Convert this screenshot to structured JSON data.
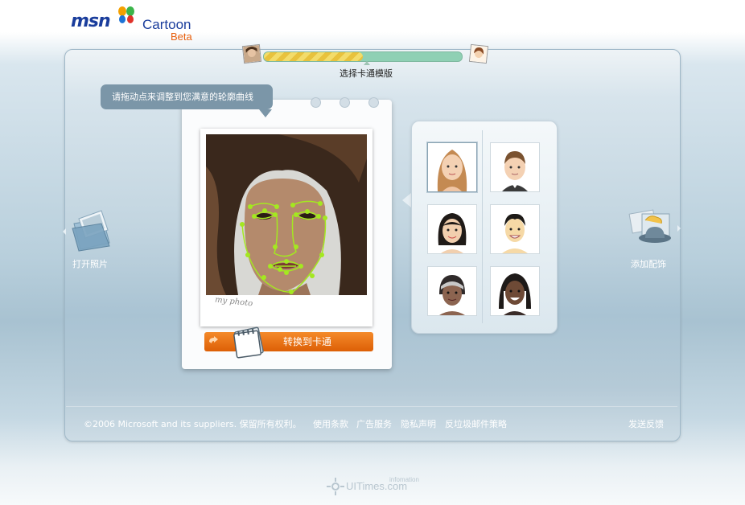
{
  "header": {
    "brand": "msn",
    "product": "Cartoon",
    "badge": "Beta"
  },
  "progress": {
    "fraction": 0.5,
    "step_label": "选择卡通模版"
  },
  "editor": {
    "tooltip": "请拖动点来调整到您满意的轮廓曲线",
    "photo_caption": "my photo",
    "convert_label": "转换到卡通"
  },
  "actions": {
    "open_photo": "打开照片",
    "add_accessory": "添加配饰"
  },
  "templates": [
    {
      "name": "template-woman-long-hair",
      "selected": true
    },
    {
      "name": "template-man-short-hair",
      "selected": false
    },
    {
      "name": "template-asian-woman",
      "selected": false
    },
    {
      "name": "template-asian-man",
      "selected": false
    },
    {
      "name": "template-woman-headband",
      "selected": false
    },
    {
      "name": "template-man-dreadlocks",
      "selected": false
    }
  ],
  "footer": {
    "copyright": "©2006 Microsoft and its suppliers. 保留所有权利。",
    "links": [
      "使用条款",
      "广告服务",
      "隐私声明",
      "反垃圾邮件策略"
    ],
    "feedback": "发送反馈"
  },
  "watermark": {
    "text": "UITimes.com",
    "subtext": "infomation"
  },
  "colors": {
    "accent_orange": "#e8600e",
    "brand_blue": "#1a3d9c",
    "face_points": "#a4e820"
  }
}
